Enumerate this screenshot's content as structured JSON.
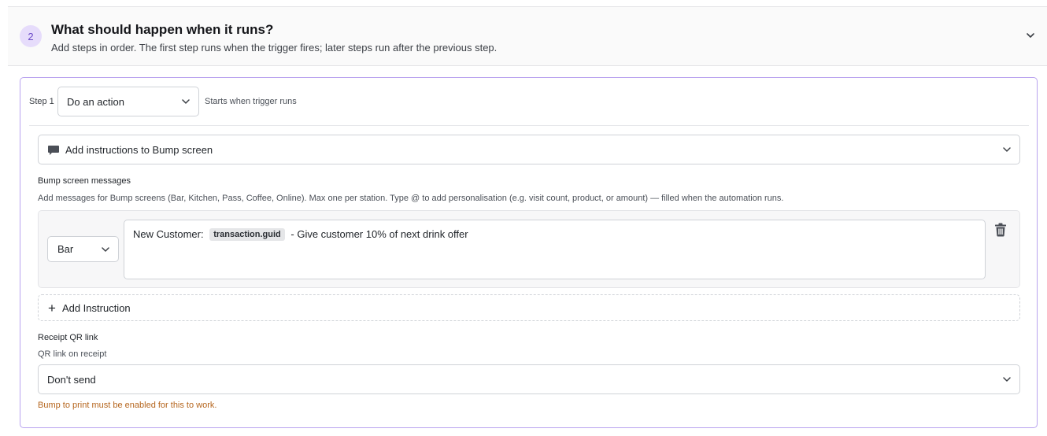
{
  "section": {
    "number": "2",
    "title": "What should happen when it runs?",
    "subtitle": "Add steps in order. The first step runs when the trigger fires; later steps run after the previous step."
  },
  "step": {
    "label": "Step 1",
    "type_value": "Do an action",
    "hint": "Starts when trigger runs"
  },
  "action": {
    "value": "Add instructions to Bump screen"
  },
  "bump": {
    "label": "Bump screen messages",
    "help": "Add messages for Bump screens (Bar, Kitchen, Pass, Coffee, Online). Max one per station. Type @ to add personalisation (e.g. visit count, product, or amount) — filled when the automation runs.",
    "station_value": "Bar",
    "message_prefix": "New Customer:",
    "message_token": "transaction.guid",
    "message_suffix": "- Give customer 10% of next drink offer",
    "add_label": "Add Instruction"
  },
  "qr": {
    "label": "Receipt QR link",
    "sublabel": "QR link on receipt",
    "value": "Don't send",
    "warning": "Bump to print must be enabled for this to work."
  },
  "colors": {
    "accent": "#b9a3ef",
    "badge_bg": "#e6dcfb",
    "badge_text": "#6a48c7",
    "warning": "#b5651d"
  }
}
